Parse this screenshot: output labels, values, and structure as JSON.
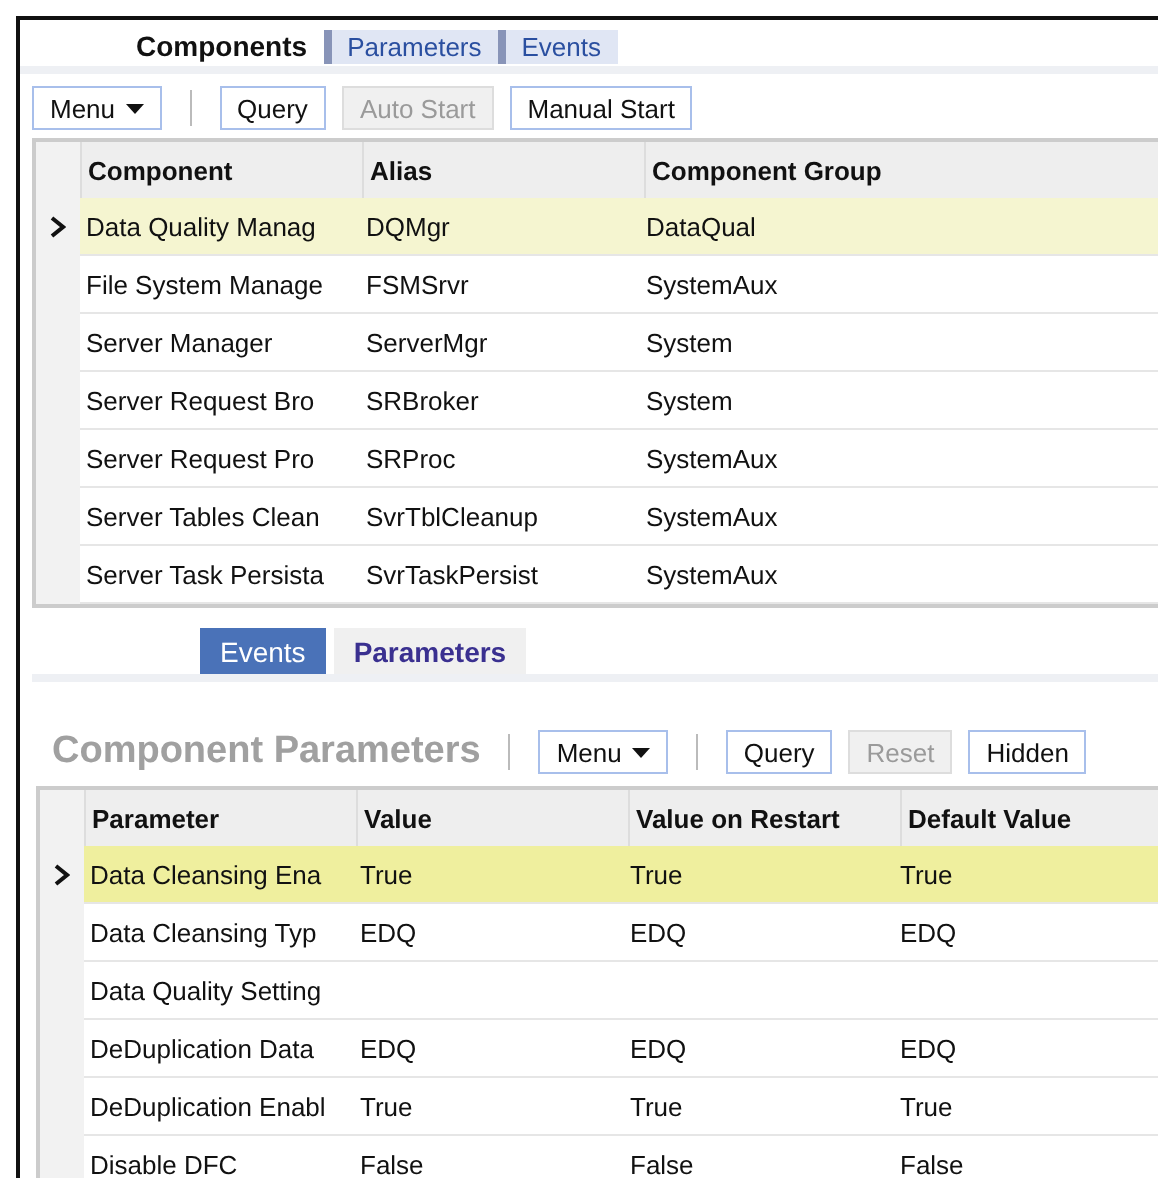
{
  "top_tabs": [
    {
      "label": "Components",
      "selected": true
    },
    {
      "label": "Parameters",
      "selected": false
    },
    {
      "label": "Events",
      "selected": false
    }
  ],
  "toolbar": [
    {
      "kind": "menu",
      "label": "Menu",
      "disabled": false
    },
    {
      "kind": "separator"
    },
    {
      "kind": "button",
      "label": "Query",
      "disabled": false
    },
    {
      "kind": "button",
      "label": "Auto Start",
      "disabled": true
    },
    {
      "kind": "button",
      "label": "Manual Start",
      "disabled": false
    }
  ],
  "components_table": {
    "columns": [
      "Component",
      "Alias",
      "Component Group"
    ],
    "rows": [
      {
        "selected": true,
        "cells": [
          "Data Quality Manag",
          "DQMgr",
          "DataQual"
        ]
      },
      {
        "selected": false,
        "cells": [
          "File System Manage",
          "FSMSrvr",
          "SystemAux"
        ]
      },
      {
        "selected": false,
        "cells": [
          "Server Manager",
          "ServerMgr",
          "System"
        ]
      },
      {
        "selected": false,
        "cells": [
          "Server Request Bro",
          "SRBroker",
          "System"
        ]
      },
      {
        "selected": false,
        "cells": [
          "Server Request Pro",
          "SRProc",
          "SystemAux"
        ]
      },
      {
        "selected": false,
        "cells": [
          "Server Tables Clean",
          "SvrTblCleanup",
          "SystemAux"
        ]
      },
      {
        "selected": false,
        "cells": [
          "Server Task Persista",
          "SvrTaskPersist",
          "SystemAux"
        ]
      }
    ]
  },
  "bottom_tabs": [
    {
      "label": "Events",
      "selected": false
    },
    {
      "label": "Parameters",
      "selected": true
    }
  ],
  "parameters_panel": {
    "title": "Component Parameters",
    "toolbar": [
      {
        "kind": "separator"
      },
      {
        "kind": "menu",
        "label": "Menu",
        "disabled": false
      },
      {
        "kind": "separator"
      },
      {
        "kind": "button",
        "label": "Query",
        "disabled": false
      },
      {
        "kind": "button",
        "label": "Reset",
        "disabled": true
      },
      {
        "kind": "button",
        "label": "Hidden",
        "disabled": false
      }
    ],
    "table": {
      "columns": [
        "Parameter",
        "Value",
        "Value on Restart",
        "Default Value"
      ],
      "rows": [
        {
          "selected": true,
          "cells": [
            "Data Cleansing Ena",
            "True",
            "True",
            "True"
          ]
        },
        {
          "selected": false,
          "cells": [
            "Data Cleansing Typ",
            "EDQ",
            "EDQ",
            "EDQ"
          ]
        },
        {
          "selected": false,
          "cells": [
            "Data Quality Setting",
            "",
            "",
            ""
          ]
        },
        {
          "selected": false,
          "cells": [
            "DeDuplication Data",
            "EDQ",
            "EDQ",
            "EDQ"
          ]
        },
        {
          "selected": false,
          "cells": [
            "DeDuplication Enabl",
            "True",
            "True",
            "True"
          ]
        },
        {
          "selected": false,
          "cells": [
            "Disable DFC",
            "False",
            "False",
            "False"
          ]
        }
      ]
    }
  }
}
